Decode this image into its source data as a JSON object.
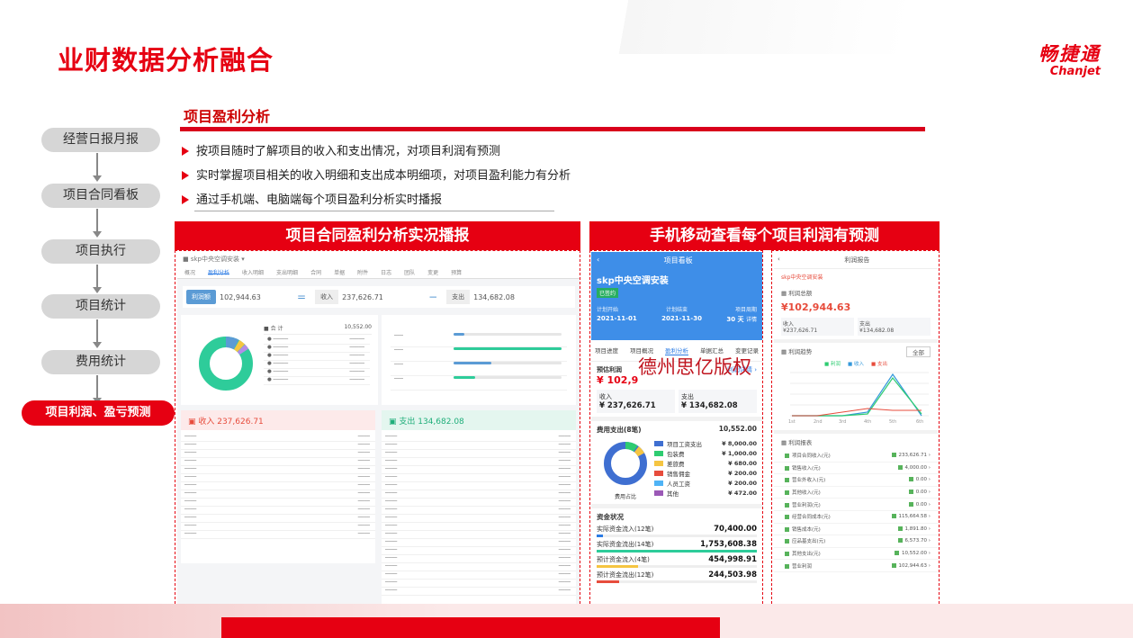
{
  "slide": {
    "title": "业财数据分析融合",
    "logo_cn": "畅捷通",
    "logo_en": "Chanjet"
  },
  "flow_steps": [
    {
      "label": "经营日报月报",
      "active": false
    },
    {
      "label": "项目合同看板",
      "active": false
    },
    {
      "label": "项目执行",
      "active": false
    },
    {
      "label": "项目统计",
      "active": false
    },
    {
      "label": "费用统计",
      "active": false
    },
    {
      "label": "项目利润、盈亏预测",
      "active": true
    }
  ],
  "section": {
    "title": "项目盈利分析",
    "bullets": [
      "按项目随时了解项目的收入和支出情况，对项目利润有预测",
      "实时掌握项目相关的收入明细和支出成本明细项，对项目盈利能力有分析",
      "通过手机端、电脑端每个项目盈利分析实时播报"
    ]
  },
  "panels": {
    "left_title": "项目合同盈利分析实况播报",
    "right_title": "手机移动查看每个项目利润有预测"
  },
  "desktop": {
    "profit_tag": "利润额",
    "profit_value": "102,944.63",
    "income_tag": "收入",
    "income_value": "237,626.71",
    "expense_tag": "支出",
    "expense_value": "134,682.08",
    "expense_total": "10,552.00",
    "income_card": "237,626.71",
    "expense_card": "134,682.08"
  },
  "mobile": {
    "header_title": "项目看板",
    "project": "skp中央空调安装",
    "badge": "已签约",
    "plan_start_label": "计划开始",
    "plan_end_label": "计划结束",
    "period_label": "项目周期",
    "plan_start": "2021-11-01",
    "plan_end": "2021-11-30",
    "period": "30 天",
    "detail": "详情",
    "tabs": [
      "项目进度",
      "项目概况",
      "盈利分析",
      "单据汇总",
      "变更记录"
    ],
    "active_tab": 2,
    "est_profit_label": "预估利润",
    "profit_detail": "利润详情",
    "est_profit": "¥ 102,9",
    "income_label": "收入",
    "income": "¥ 237,626.71",
    "expense_label": "支出",
    "expense": "¥ 134,682.08",
    "expense_section": "费用支出(8笔)",
    "expense_total": "10,552.00",
    "expense_items": [
      {
        "name": "项目工资支出",
        "amount": "¥ 8,000.00",
        "color": "#3f6fd1"
      },
      {
        "name": "包装费",
        "amount": "¥ 1,000.00",
        "color": "#2ecc71"
      },
      {
        "name": "差旅费",
        "amount": "¥ 680.00",
        "color": "#f5c542"
      },
      {
        "name": "销售佣金",
        "amount": "¥ 200.00",
        "color": "#e74c3c"
      },
      {
        "name": "人员工资",
        "amount": "¥ 200.00",
        "color": "#4fb3f6"
      },
      {
        "name": "其他",
        "amount": "¥ 472.00",
        "color": "#9b59b6"
      }
    ],
    "donut_caption": "费用占比",
    "capital_title": "资金状况",
    "capital": [
      {
        "label": "实际资金流入(12笔)",
        "value": "70,400.00",
        "color": "#2b7be4",
        "frac": 0.04
      },
      {
        "label": "实际资金流出(14笔)",
        "value": "1,753,608.38",
        "color": "#2ecc9a",
        "frac": 1.0
      },
      {
        "label": "预计资金流入(4笔)",
        "value": "454,998.91",
        "color": "#f5c542",
        "frac": 0.26
      },
      {
        "label": "预计资金流出(12笔)",
        "value": "244,503.98",
        "color": "#e74c3c",
        "frac": 0.14
      }
    ]
  },
  "report": {
    "title": "利润报告",
    "project": "skp中央空调安装",
    "net_profit_label": "利润总额",
    "net_profit": "¥102,944.63",
    "income_label": "收入",
    "income": "¥237,626.71",
    "expense_label": "支出",
    "expense": "¥134,682.08",
    "trend_label": "利润趋势",
    "trend_btn": "全部",
    "legend": [
      "利润",
      "收入",
      "支出"
    ],
    "xlabels": [
      "1st",
      "2nd",
      "3rd",
      "4th",
      "5th",
      "6th"
    ],
    "table_title": "利润报表",
    "rows": [
      {
        "label": "项目合同收入(元)",
        "value": "233,626.71"
      },
      {
        "label": "销售收入(元)",
        "value": "4,000.00"
      },
      {
        "label": "营业外收入(元)",
        "value": "0.00"
      },
      {
        "label": "其他收入(元)",
        "value": "0.00"
      },
      {
        "label": "营业利润(元)",
        "value": "0.00"
      },
      {
        "label": "经营合同成本(元)",
        "value": "115,664.58"
      },
      {
        "label": "销售成本(元)",
        "value": "1,891.80"
      },
      {
        "label": "应品基支出(元)",
        "value": "6,573.70"
      },
      {
        "label": "其他支出(元)",
        "value": "10,552.00"
      },
      {
        "label": "营业利润",
        "value": "102,944.63"
      }
    ]
  },
  "watermark": "德州思亿版权"
}
